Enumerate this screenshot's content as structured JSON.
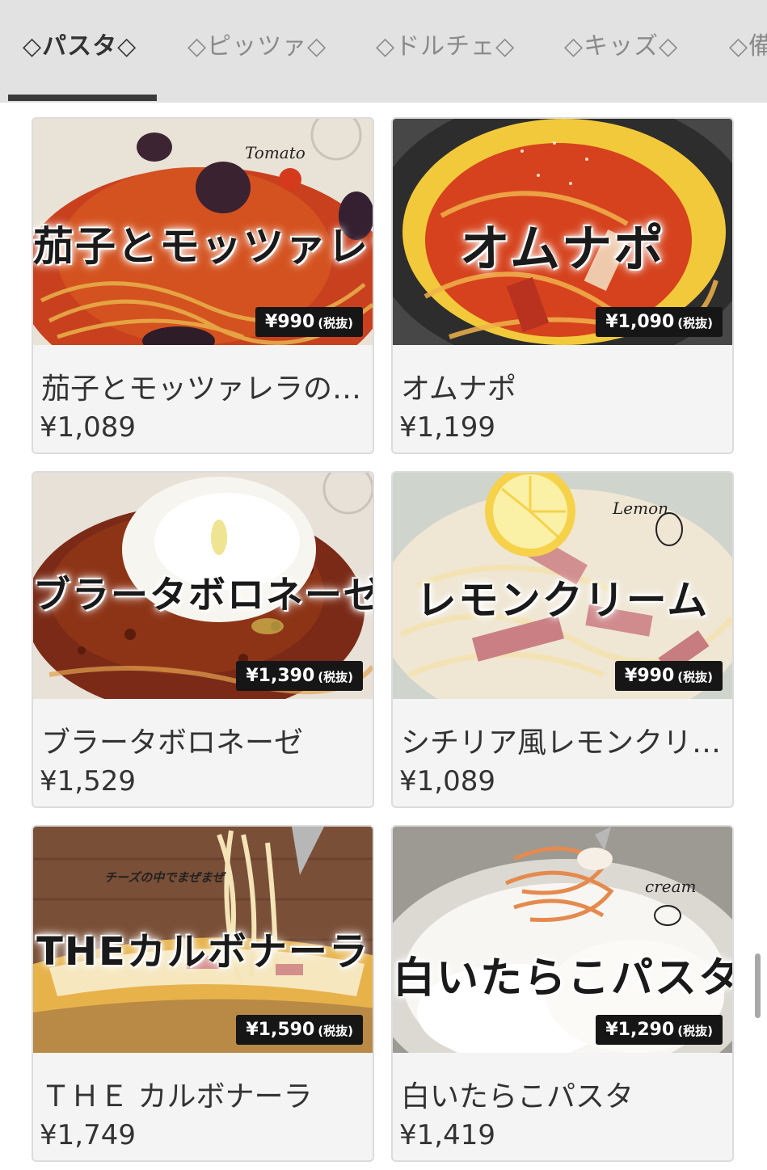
{
  "tabs": [
    {
      "label": "◇パスタ◇",
      "active": true
    },
    {
      "label": "◇ピッツァ◇",
      "active": false
    },
    {
      "label": "◇ドルチェ◇",
      "active": false
    },
    {
      "label": "◇キッズ◇",
      "active": false
    },
    {
      "label": "◇備",
      "active": false
    }
  ],
  "items": [
    {
      "photo_title": "茄子とモッツァレラ",
      "photo_price": "¥990",
      "tax_note": "(税抜)",
      "deco": "Tomato",
      "name": "茄子とモッツァレラの…",
      "price": "¥1,089"
    },
    {
      "photo_title": "オムナポ",
      "photo_price": "¥1,090",
      "tax_note": "(税抜)",
      "deco": "",
      "name": "オムナポ",
      "price": "¥1,199"
    },
    {
      "photo_title": "ブラータボロネーゼ",
      "photo_price": "¥1,390",
      "tax_note": "(税抜)",
      "deco": "",
      "name": "ブラータボロネーゼ",
      "price": "¥1,529"
    },
    {
      "photo_title": "レモンクリーム",
      "photo_price": "¥990",
      "tax_note": "(税抜)",
      "deco": "Lemon",
      "name": "シチリア風レモンクリ…",
      "price": "¥1,089"
    },
    {
      "photo_title": "THEカルボナーラ",
      "photo_price": "¥1,590",
      "tax_note": "(税抜)",
      "deco": "チーズの中でまぜまぜ",
      "name": "ＴＨＥ カルボナーラ",
      "price": "¥1,749"
    },
    {
      "photo_title": "白いたらこパスタ",
      "photo_price": "¥1,290",
      "tax_note": "(税抜)",
      "deco": "cream",
      "name": "白いたらこパスタ",
      "price": "¥1,419"
    }
  ]
}
